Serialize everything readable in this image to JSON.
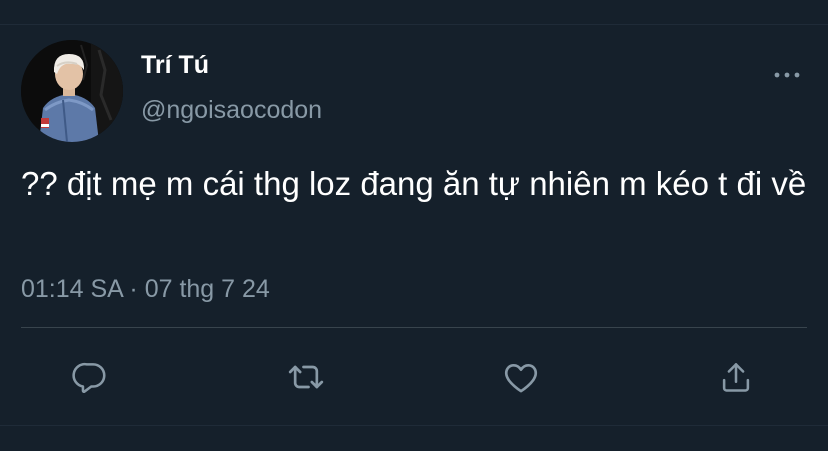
{
  "tweet": {
    "author": {
      "display_name": "Trí Tú",
      "handle": "@ngoisaocodon",
      "avatar_icon": "user-avatar-photo"
    },
    "text": "?? địt mẹ m cái thg loz đang ăn tự nhiên m kéo t đi về",
    "meta": "01:14 SA · 07 thg 7 24",
    "more_icon": "more-horizontal-icon"
  },
  "actions": [
    {
      "name": "reply",
      "icon": "reply-icon"
    },
    {
      "name": "retweet",
      "icon": "retweet-icon"
    },
    {
      "name": "like",
      "icon": "heart-icon"
    },
    {
      "name": "share",
      "icon": "share-icon"
    }
  ],
  "colors": {
    "background": "#15202b",
    "primary_text": "#ffffff",
    "secondary_text": "#8899a6",
    "divider": "#38444d"
  }
}
